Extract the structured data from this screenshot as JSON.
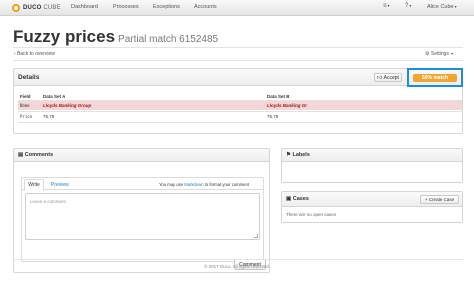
{
  "navbar": {
    "brand_bold": "DUCO",
    "brand_light": "CUBE",
    "items": [
      "Dashboard",
      "Processes",
      "Exceptions",
      "Accounts"
    ],
    "menu_icon": "hamburger-icon",
    "help_icon": "question-icon",
    "user": "Alice Cube"
  },
  "header": {
    "title": "Fuzzy prices",
    "subtitle": "Partial match 6152485",
    "back_label": "Back to overview",
    "settings_label": "Settings"
  },
  "details": {
    "title": "Details",
    "accept_label": "Accept",
    "match_label": "50% match",
    "match_color": "#f0a630",
    "columns": [
      "Field",
      "Data Set A",
      "Data Set B"
    ],
    "rows": [
      {
        "field": "Name",
        "a": "Lloyds Banking Group",
        "b": "Lloyds Banking Gr",
        "mismatch": true
      },
      {
        "field": "Price",
        "a": "75.79",
        "b": "75.79",
        "mismatch": false
      }
    ]
  },
  "comments": {
    "title": "Comments",
    "tab_write": "Write",
    "tab_preview": "Preview",
    "hint_prefix": "You may use",
    "hint_link": "Markdown",
    "hint_suffix": "to format your comment",
    "placeholder": "Leave a comment",
    "submit_label": "Comment"
  },
  "labels": {
    "title": "Labels"
  },
  "cases": {
    "title": "Cases",
    "create_label": "Create Case",
    "empty_text": "There are no open cases"
  },
  "footer": {
    "text": "© 2017 Duco. All rights reserved."
  }
}
